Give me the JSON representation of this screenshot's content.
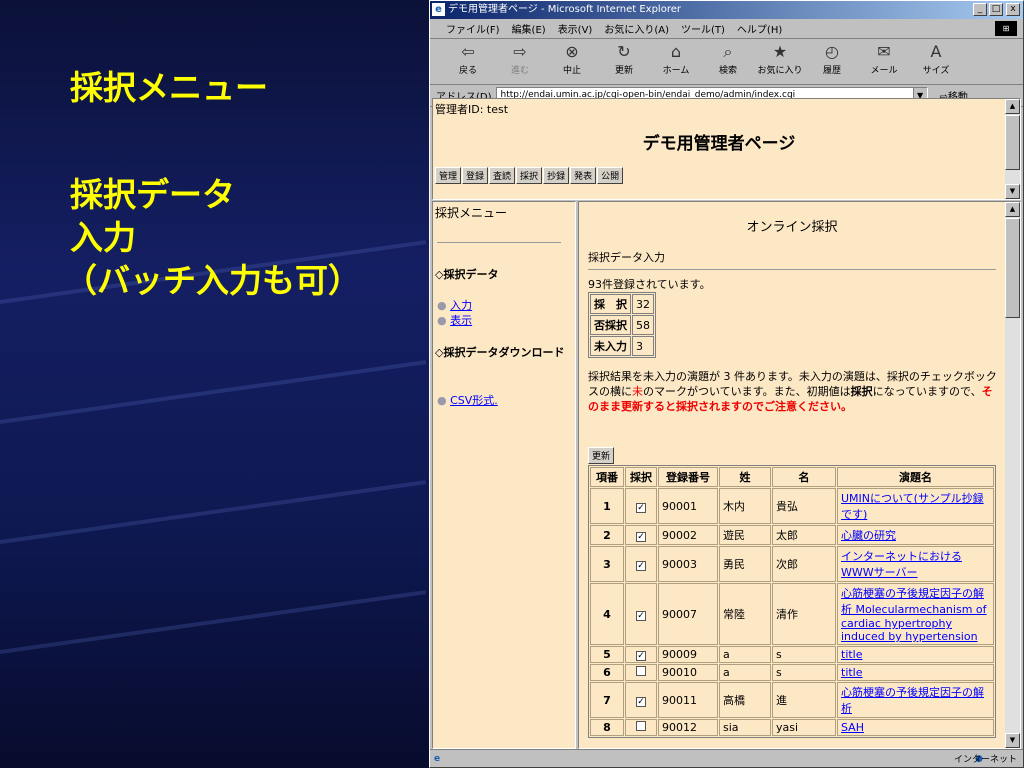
{
  "slide": {
    "line1": "採択メニュー",
    "line2": "採択データ",
    "line3": "入力",
    "line4": "（バッチ入力も可）"
  },
  "window": {
    "title": "デモ用管理者ページ - Microsoft Internet Explorer",
    "min": "_",
    "max": "□",
    "close": "x"
  },
  "menu": [
    "ファイル(F)",
    "編集(E)",
    "表示(V)",
    "お気に入り(A)",
    "ツール(T)",
    "ヘルプ(H)"
  ],
  "toolbar": [
    {
      "label": "戻る",
      "icon": "back-arrow-icon",
      "glyph": "⇦"
    },
    {
      "label": "進む",
      "icon": "forward-arrow-icon",
      "glyph": "⇨"
    },
    {
      "label": "中止",
      "icon": "stop-icon",
      "glyph": "⊗"
    },
    {
      "label": "更新",
      "icon": "refresh-icon",
      "glyph": "↻"
    },
    {
      "label": "ホーム",
      "icon": "home-icon",
      "glyph": "⌂"
    },
    {
      "label": "検索",
      "icon": "search-icon",
      "glyph": "⌕"
    },
    {
      "label": "お気に入り",
      "icon": "favorites-icon",
      "glyph": "★"
    },
    {
      "label": "履歴",
      "icon": "history-icon",
      "glyph": "◴"
    },
    {
      "label": "メール",
      "icon": "mail-icon",
      "glyph": "✉"
    },
    {
      "label": "サイズ",
      "icon": "font-size-icon",
      "glyph": "A"
    }
  ],
  "address": {
    "label": "アドレス(D)",
    "url": "http://endai.umin.ac.jp/cgi-open-bin/endai_demo/admin/index.cgi",
    "go": "移動"
  },
  "top": {
    "admin": "管理者ID: test",
    "title": "デモ用管理者ページ",
    "nav": [
      "管理",
      "登録",
      "査読",
      "採択",
      "抄録",
      "発表",
      "公開"
    ]
  },
  "left": {
    "title": "採択メニュー",
    "section1": "◇採択データ",
    "links1": [
      "入力",
      "表示"
    ],
    "section2": "◇採択データダウンロード",
    "links2": [
      "CSV形式."
    ]
  },
  "main": {
    "title": "オンライン採択",
    "subtitle": "採択データ入力",
    "registered": "93件登録されています。",
    "counts": [
      {
        "label": "採　択",
        "value": "32"
      },
      {
        "label": "否採択",
        "value": "58"
      },
      {
        "label": "未入力",
        "value": "3"
      }
    ],
    "notice_a": "採択結果を未入力の演題が 3 件あります。未入力の演題は、採択のチェックボックスの横に",
    "notice_mark": "未",
    "notice_b": "のマークがついています。また、初期値は",
    "notice_bold": "採択",
    "notice_c": "になっていますので、",
    "notice_warn": "そのまま更新すると採択されますのでご注意ください。",
    "update_button": "更新",
    "headers": [
      "項番",
      "採択",
      "登録番号",
      "姓",
      "名",
      "演題名"
    ],
    "rows": [
      {
        "no": "1",
        "checked": true,
        "id": "90001",
        "sei": "木内",
        "mei": "貴弘",
        "title": "UMINについて(サンプル抄録です)"
      },
      {
        "no": "2",
        "checked": true,
        "id": "90002",
        "sei": "遊民",
        "mei": "太郎",
        "title": "心臓の研究"
      },
      {
        "no": "3",
        "checked": true,
        "id": "90003",
        "sei": "勇民",
        "mei": "次郎",
        "title": "インターネットにおけるWWWサーバー"
      },
      {
        "no": "4",
        "checked": true,
        "id": "90007",
        "sei": "常陸",
        "mei": "清作",
        "title": "心筋梗塞の予後規定因子の解析 Molecularmechanism of cardiac hypertrophy induced by hypertension"
      },
      {
        "no": "5",
        "checked": true,
        "id": "90009",
        "sei": "a",
        "mei": "s",
        "title": "title"
      },
      {
        "no": "6",
        "checked": false,
        "id": "90010",
        "sei": "a",
        "mei": "s",
        "title": "title"
      },
      {
        "no": "7",
        "checked": true,
        "id": "90011",
        "sei": "高橋",
        "mei": "進",
        "title": "心筋梗塞の予後規定因子の解析"
      },
      {
        "no": "8",
        "checked": false,
        "id": "90012",
        "sei": "sia",
        "mei": "yasi",
        "title": "SAH"
      }
    ]
  },
  "status": {
    "zone": "インターネット"
  }
}
